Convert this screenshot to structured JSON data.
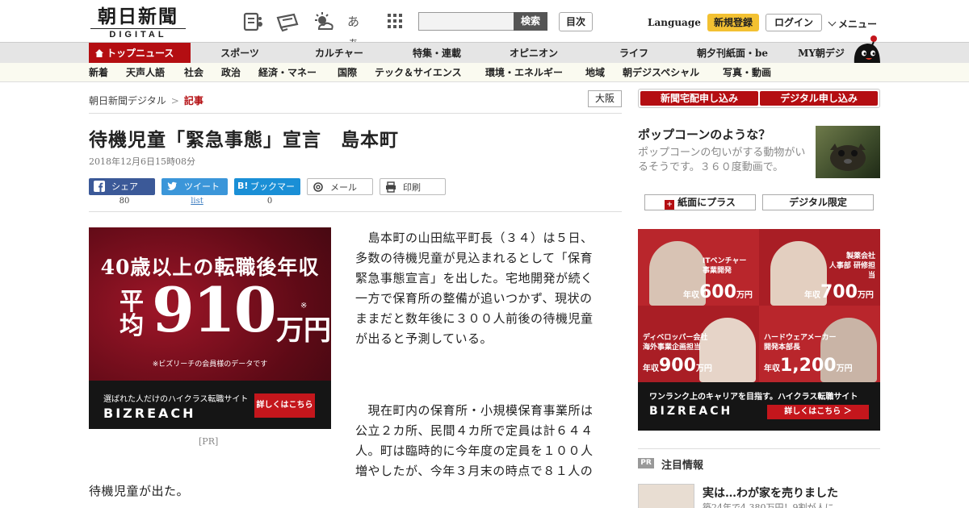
{
  "header": {
    "logo_jp": "朝日新聞",
    "logo_en": "DIGITAL",
    "search_button": "検索",
    "mokuji": "目次",
    "language": "Language",
    "register": "新規登録",
    "login": "ログイン",
    "menu": "メニュー",
    "moji_icon_text": "あぁ"
  },
  "nav_primary": {
    "top_news": "トップニュース",
    "items": [
      "スポーツ",
      "カルチャー",
      "特集・連載",
      "オピニオン",
      "ライフ",
      "朝夕刊紙面・be",
      "MY朝デジ"
    ]
  },
  "nav_secondary": {
    "items": [
      "新着",
      "天声人語",
      "社会",
      "政治",
      "経済・マネー",
      "国際",
      "テック＆サイエンス",
      "環境・エネルギー",
      "地域",
      "朝デジスペシャル",
      "写真・動画"
    ]
  },
  "breadcrumb": {
    "home": "朝日新聞デジタル",
    "separator": ">",
    "current": "記事"
  },
  "edition": "大阪",
  "article": {
    "title": "待機児童「緊急事態」宣言　島本町",
    "date": "2018年12月6日15時08分",
    "para1_lines": [
      "　島本町の山田紘平町長（３４）は５日、",
      "多数の待機児童が見込まれるとして「保育",
      "緊急事態宣言」を出した。宅地開発が続く",
      "一方で保育所の整備が追いつかず、現状の",
      "ままだと数年後に３００人前後の待機児童",
      "が出ると予測している。"
    ],
    "para2_lines": [
      "　現在町内の保育所・小規模保育事業所は",
      "公立２カ所、民間４カ所で定員は計６４４",
      "人。町は臨時的に今年度の定員を１００人",
      "増やしたが、今年３月末の時点で８１人の"
    ],
    "para2_last": "待機児童が出た。"
  },
  "share": {
    "facebook": "シェア",
    "facebook_count": "80",
    "twitter": "ツイート",
    "twitter_count": "list",
    "hatena": "ブックマーク",
    "hatena_count": "0",
    "mail": "メール",
    "print": "印刷"
  },
  "ad_left": {
    "line1": "40歳以上の転職後年収",
    "heikin": "平均",
    "amount": "910",
    "unit": "万円",
    "mark": "※",
    "note": "※ビズリーチの会員様のデータです",
    "tagline": "選ばれた人だけのハイクラス転職サイト",
    "brand": "BIZREACH",
    "button": "詳しくはこちら",
    "pr_label": "[PR]"
  },
  "sidebar": {
    "subscribe_paper": "新聞宅配申し込み",
    "subscribe_digital": "デジタル申し込み",
    "feature_title": "ポップコーンのような？",
    "feature_desc": "ポップコーンの匂いがする動物がいるそうです。３６０度動画で。",
    "paper_plus": "紙面にプラス",
    "digital_only": "デジタル限定"
  },
  "ad_right": {
    "cells": [
      {
        "role": "ITベンチャー\n事業開発",
        "prefix": "年収",
        "amount": "600",
        "unit": "万円"
      },
      {
        "role": "製薬会社\n人事部 研修担当",
        "prefix": "年収",
        "amount": "700",
        "unit": "万円"
      },
      {
        "role": "ディベロッパー会社\n海外事業企画担当",
        "prefix": "年収",
        "amount": "900",
        "unit": "万円"
      },
      {
        "role": "ハードウェアメーカー\n開発本部長",
        "prefix": "年収",
        "amount": "1,200",
        "unit": "万円"
      }
    ],
    "tagline": "ワンランク上のキャリアを目指す。ハイクラス転職サイト",
    "brand": "BIZREACH",
    "button": "詳しくはこちら ＞"
  },
  "attention": {
    "pr_tag": "PR",
    "heading": "注目情報",
    "item_title": "実は…わが家を売りました",
    "item_desc": "築24年で4,380万円！9割が人に"
  }
}
